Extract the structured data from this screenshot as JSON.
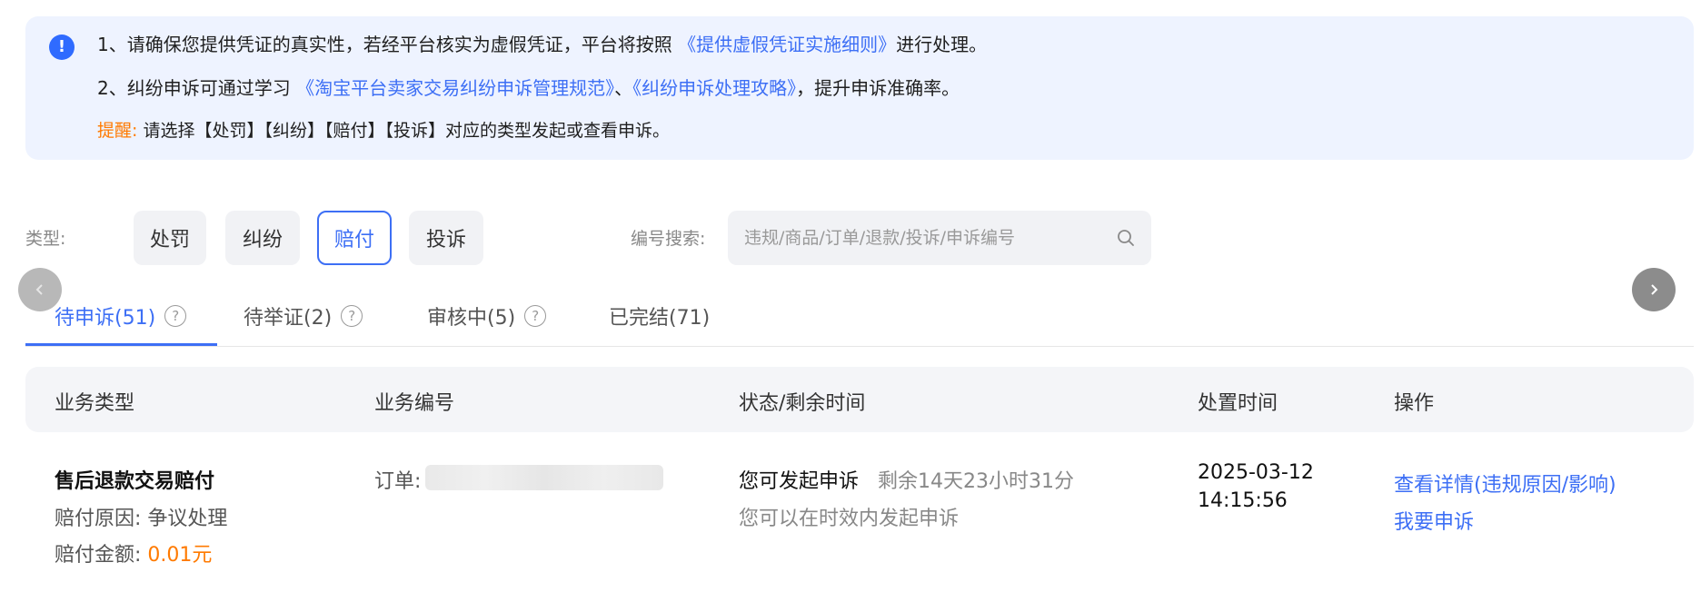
{
  "notice": {
    "line1_prefix": "1、请确保您提供凭证的真实性，若经平台核实为虚假凭证，平台将按照",
    "line1_link": "《提供虚假凭证实施细则》",
    "line1_suffix": "进行处理。",
    "line2_prefix": "2、纠纷申诉可通过学习",
    "line2_link1": "《淘宝平台卖家交易纠纷申诉管理规范》",
    "line2_sep": "、",
    "line2_link2": "《纠纷申诉处理攻略》",
    "line2_suffix": "，提升申诉准确率。",
    "reminder_label": "提醒:",
    "reminder_text": "请选择【处罚】【纠纷】【赔付】【投诉】对应的类型发起或查看申诉。",
    "icon": "exclamation-icon"
  },
  "filters": {
    "type_label": "类型:",
    "types": [
      "处罚",
      "纠纷",
      "赔付",
      "投诉"
    ],
    "active_type": "赔付",
    "search_label": "编号搜索:",
    "search_placeholder": "违规/商品/订单/退款/投诉/申诉编号",
    "search_value": ""
  },
  "tabs": [
    {
      "label": "待申诉(51)",
      "active": true,
      "help": true
    },
    {
      "label": "待举证(2)",
      "active": false,
      "help": true
    },
    {
      "label": "审核中(5)",
      "active": false,
      "help": true
    },
    {
      "label": "已完结(71)",
      "active": false,
      "help": false
    }
  ],
  "table": {
    "headers": [
      "业务类型",
      "业务编号",
      "状态/剩余时间",
      "处置时间",
      "操作"
    ],
    "rows": [
      {
        "business_type": "售后退款交易赔付",
        "reason_label": "赔付原因:",
        "reason_value": "争议处理",
        "amount_label": "赔付金额:",
        "amount_value": "0.01元",
        "order_label": "订单:",
        "status": "您可发起申诉",
        "remaining": "剩余14天23小时31分",
        "status_note": "您可以在时效内发起申诉",
        "date": "2025-03-12",
        "time": "14:15:56",
        "action_detail": "查看详情(违规原因/影响)",
        "action_appeal": "我要申诉"
      }
    ]
  },
  "colors": {
    "accent": "#3d6ff5",
    "warning": "#ff7a00",
    "notice_bg": "#eef3ff"
  }
}
